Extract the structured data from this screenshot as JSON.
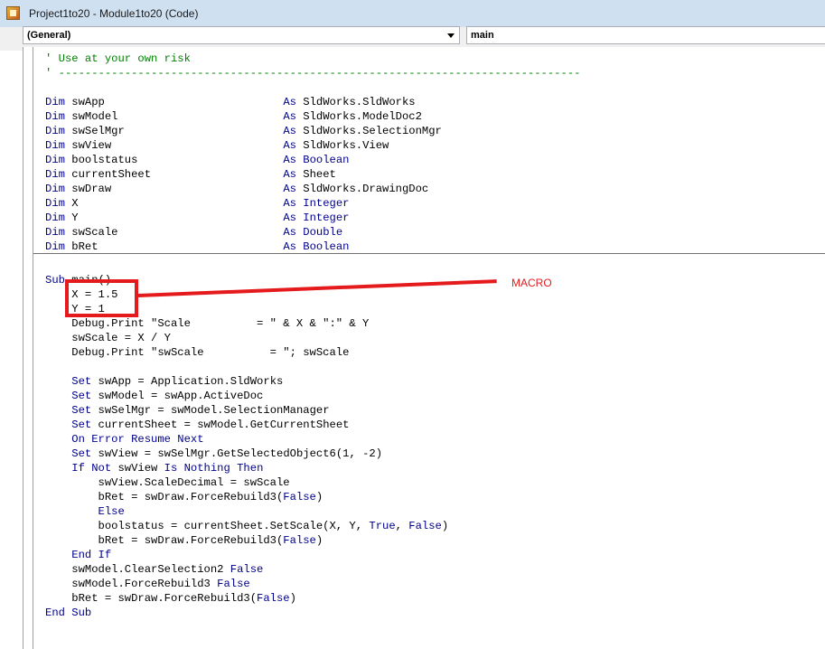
{
  "window": {
    "title": "Project1to20 - Module1to20 (Code)"
  },
  "combos": {
    "object": "(General)",
    "procedure": "main"
  },
  "annotation": {
    "label": "MACRO"
  },
  "colors": {
    "keyword": "#00008b",
    "comment": "#007f00",
    "annotation": "#e41a1c"
  },
  "code": {
    "lines": [
      {
        "parts": [
          {
            "t": "' Use at your own risk",
            "c": "cm"
          }
        ]
      },
      {
        "parts": [
          {
            "t": "' -------------------------------------------------------------------------------",
            "c": "cm"
          }
        ]
      },
      {
        "parts": []
      },
      {
        "parts": [
          {
            "t": "Dim",
            "c": "kw"
          },
          {
            "t": " swApp                           "
          },
          {
            "t": "As",
            "c": "kw"
          },
          {
            "t": " SldWorks.SldWorks"
          }
        ]
      },
      {
        "parts": [
          {
            "t": "Dim",
            "c": "kw"
          },
          {
            "t": " swModel                         "
          },
          {
            "t": "As",
            "c": "kw"
          },
          {
            "t": " SldWorks.ModelDoc2"
          }
        ]
      },
      {
        "parts": [
          {
            "t": "Dim",
            "c": "kw"
          },
          {
            "t": " swSelMgr                        "
          },
          {
            "t": "As",
            "c": "kw"
          },
          {
            "t": " SldWorks.SelectionMgr"
          }
        ]
      },
      {
        "parts": [
          {
            "t": "Dim",
            "c": "kw"
          },
          {
            "t": " swView                          "
          },
          {
            "t": "As",
            "c": "kw"
          },
          {
            "t": " SldWorks.View"
          }
        ]
      },
      {
        "parts": [
          {
            "t": "Dim",
            "c": "kw"
          },
          {
            "t": " boolstatus                      "
          },
          {
            "t": "As",
            "c": "kw"
          },
          {
            "t": " Boolean",
            "c": "kw"
          }
        ]
      },
      {
        "parts": [
          {
            "t": "Dim",
            "c": "kw"
          },
          {
            "t": " currentSheet                    "
          },
          {
            "t": "As",
            "c": "kw"
          },
          {
            "t": " Sheet"
          }
        ]
      },
      {
        "parts": [
          {
            "t": "Dim",
            "c": "kw"
          },
          {
            "t": " swDraw                          "
          },
          {
            "t": "As",
            "c": "kw"
          },
          {
            "t": " SldWorks.DrawingDoc"
          }
        ]
      },
      {
        "parts": [
          {
            "t": "Dim",
            "c": "kw"
          },
          {
            "t": " X                               "
          },
          {
            "t": "As",
            "c": "kw"
          },
          {
            "t": " Integer",
            "c": "kw"
          }
        ]
      },
      {
        "parts": [
          {
            "t": "Dim",
            "c": "kw"
          },
          {
            "t": " Y                               "
          },
          {
            "t": "As",
            "c": "kw"
          },
          {
            "t": " Integer",
            "c": "kw"
          }
        ]
      },
      {
        "parts": [
          {
            "t": "Dim",
            "c": "kw"
          },
          {
            "t": " swScale                         "
          },
          {
            "t": "As",
            "c": "kw"
          },
          {
            "t": " Double",
            "c": "kw"
          }
        ]
      },
      {
        "parts": [
          {
            "t": "Dim",
            "c": "kw"
          },
          {
            "t": " bRet                            "
          },
          {
            "t": "As",
            "c": "kw"
          },
          {
            "t": " Boolean",
            "c": "kw"
          }
        ]
      },
      {
        "parts": []
      },
      {
        "parts": [
          {
            "t": "Sub",
            "c": "kw"
          },
          {
            "t": " main()"
          }
        ]
      },
      {
        "parts": [
          {
            "t": "    X = 1.5"
          }
        ]
      },
      {
        "parts": [
          {
            "t": "    Y = 1"
          }
        ]
      },
      {
        "parts": [
          {
            "t": "    Debug.Print \"Scale          = \" & X & \":\" & Y"
          }
        ]
      },
      {
        "parts": [
          {
            "t": "    swScale = X / Y"
          }
        ]
      },
      {
        "parts": [
          {
            "t": "    Debug.Print \"swScale          = \"; swScale"
          }
        ]
      },
      {
        "parts": []
      },
      {
        "parts": [
          {
            "t": "    "
          },
          {
            "t": "Set",
            "c": "kw"
          },
          {
            "t": " swApp = Application.SldWorks"
          }
        ]
      },
      {
        "parts": [
          {
            "t": "    "
          },
          {
            "t": "Set",
            "c": "kw"
          },
          {
            "t": " swModel = swApp.ActiveDoc"
          }
        ]
      },
      {
        "parts": [
          {
            "t": "    "
          },
          {
            "t": "Set",
            "c": "kw"
          },
          {
            "t": " swSelMgr = swModel.SelectionManager"
          }
        ]
      },
      {
        "parts": [
          {
            "t": "    "
          },
          {
            "t": "Set",
            "c": "kw"
          },
          {
            "t": " currentSheet = swModel.GetCurrentSheet"
          }
        ]
      },
      {
        "parts": [
          {
            "t": "    "
          },
          {
            "t": "On Error Resume Next",
            "c": "kw"
          }
        ]
      },
      {
        "parts": [
          {
            "t": "    "
          },
          {
            "t": "Set",
            "c": "kw"
          },
          {
            "t": " swView = swSelMgr.GetSelectedObject6(1, -2)"
          }
        ]
      },
      {
        "parts": [
          {
            "t": "    "
          },
          {
            "t": "If Not",
            "c": "kw"
          },
          {
            "t": " swView "
          },
          {
            "t": "Is Nothing Then",
            "c": "kw"
          }
        ]
      },
      {
        "parts": [
          {
            "t": "        swView.ScaleDecimal = swScale"
          }
        ]
      },
      {
        "parts": [
          {
            "t": "        bRet = swDraw.ForceRebuild3("
          },
          {
            "t": "False",
            "c": "kw"
          },
          {
            "t": ")"
          }
        ]
      },
      {
        "parts": [
          {
            "t": "        "
          },
          {
            "t": "Else",
            "c": "kw"
          }
        ]
      },
      {
        "parts": [
          {
            "t": "        boolstatus = currentSheet.SetScale(X, Y, "
          },
          {
            "t": "True",
            "c": "kw"
          },
          {
            "t": ", "
          },
          {
            "t": "False",
            "c": "kw"
          },
          {
            "t": ")"
          }
        ]
      },
      {
        "parts": [
          {
            "t": "        bRet = swDraw.ForceRebuild3("
          },
          {
            "t": "False",
            "c": "kw"
          },
          {
            "t": ")"
          }
        ]
      },
      {
        "parts": [
          {
            "t": "    "
          },
          {
            "t": "End If",
            "c": "kw"
          }
        ]
      },
      {
        "parts": [
          {
            "t": "    swModel.ClearSelection2 "
          },
          {
            "t": "False",
            "c": "kw"
          }
        ]
      },
      {
        "parts": [
          {
            "t": "    swModel.ForceRebuild3 "
          },
          {
            "t": "False",
            "c": "kw"
          }
        ]
      },
      {
        "parts": [
          {
            "t": "    bRet = swDraw.ForceRebuild3("
          },
          {
            "t": "False",
            "c": "kw"
          },
          {
            "t": ")"
          }
        ]
      },
      {
        "parts": [
          {
            "t": "End Sub",
            "c": "kw"
          }
        ]
      }
    ]
  }
}
